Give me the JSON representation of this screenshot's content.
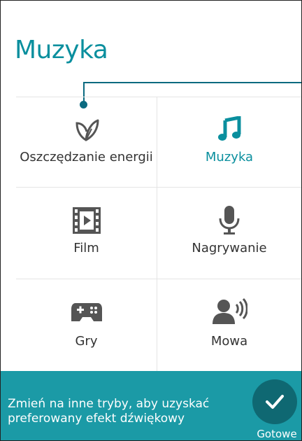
{
  "header": {
    "title": "Muzyka"
  },
  "modes": [
    {
      "label": "Oszczędzanie energii",
      "icon": "leaf-icon",
      "active": false
    },
    {
      "label": "Muzyka",
      "icon": "music-note-icon",
      "active": true
    },
    {
      "label": "Film",
      "icon": "film-icon",
      "active": false
    },
    {
      "label": "Nagrywanie",
      "icon": "microphone-icon",
      "active": false
    },
    {
      "label": "Gry",
      "icon": "gamepad-icon",
      "active": false
    },
    {
      "label": "Mowa",
      "icon": "speech-icon",
      "active": false
    }
  ],
  "footer": {
    "hint": "Zmień na inne tryby, aby uzyskać preferowany efekt dźwiękowy",
    "done_label": "Gotowe"
  },
  "colors": {
    "accent": "#0a8f9e",
    "footer": "#1b9aa6",
    "done_button": "#0f6872",
    "callout": "#0b6a80"
  }
}
